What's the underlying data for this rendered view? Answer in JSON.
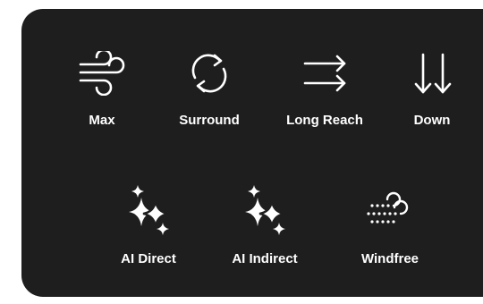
{
  "modes_row1": [
    {
      "label": "Max",
      "icon": "wind-icon"
    },
    {
      "label": "Surround",
      "icon": "rotate-icon"
    },
    {
      "label": "Long Reach",
      "icon": "double-arrow-right-icon"
    },
    {
      "label": "Down",
      "icon": "double-arrow-down-icon"
    }
  ],
  "modes_row2": [
    {
      "label": "AI Direct",
      "icon": "sparkle-icon"
    },
    {
      "label": "AI Indirect",
      "icon": "sparkle-icon"
    },
    {
      "label": "Windfree",
      "icon": "windfree-icon"
    }
  ],
  "colors": {
    "panel_bg": "#1e1e1e",
    "icon": "#ffffff",
    "text": "#ffffff"
  }
}
